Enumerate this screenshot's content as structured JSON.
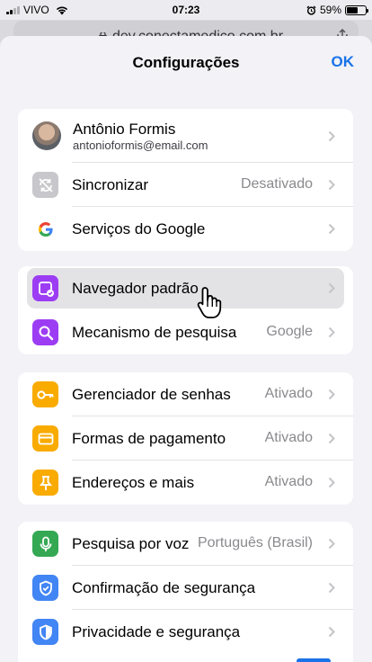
{
  "status_bar": {
    "carrier": "VIVO",
    "time": "07:23",
    "battery": "59%",
    "battery_level": 0.59
  },
  "url_bar": {
    "url": "dev.conectamedico.com.br"
  },
  "header": {
    "title": "Configurações",
    "done_label": "OK"
  },
  "account": {
    "name": "Antônio Formis",
    "email": "antonioformis@email.com"
  },
  "group1": [
    {
      "label": "Sincronizar",
      "value": "Desativado",
      "icon": "sync-off-icon",
      "color": "#c7c7cc"
    },
    {
      "label": "Serviços do Google",
      "value": "",
      "icon": "google-g-icon",
      "color": "#ffffff"
    }
  ],
  "group2": [
    {
      "label": "Navegador padrão",
      "value": "",
      "icon": "default-browser-icon",
      "color": "#9c3df4",
      "highlighted": true
    },
    {
      "label": "Mecanismo de pesquisa",
      "value": "Google",
      "icon": "search-icon",
      "color": "#9c3df4"
    }
  ],
  "group3": [
    {
      "label": "Gerenciador de senhas",
      "value": "Ativado",
      "icon": "key-icon",
      "color": "#f9ab00"
    },
    {
      "label": "Formas de pagamento",
      "value": "Ativado",
      "icon": "credit-card-icon",
      "color": "#f9ab00"
    },
    {
      "label": "Endereços e mais",
      "value": "Ativado",
      "icon": "pin-icon",
      "color": "#f9ab00"
    }
  ],
  "group4": [
    {
      "label": "Pesquisa por voz",
      "value": "Português (Brasil)",
      "icon": "microphone-icon",
      "color": "#34a853"
    },
    {
      "label": "Confirmação de segurança",
      "value": "",
      "icon": "shield-check-icon",
      "color": "#4285f4"
    },
    {
      "label": "Privacidade e segurança",
      "value": "",
      "icon": "shield-icon",
      "color": "#4285f4"
    }
  ]
}
